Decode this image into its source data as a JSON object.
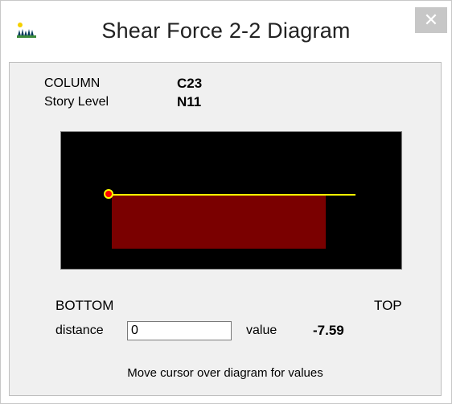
{
  "window": {
    "title": "Shear Force 2-2 Diagram",
    "close_label": "✕"
  },
  "info": {
    "column_label": "COLUMN",
    "column_value": "C23",
    "story_label": "Story Level",
    "story_value": "N11"
  },
  "diagram": {
    "fill_color": "#7a0000",
    "line_color": "#ffff00",
    "marker_color": "#ff0000",
    "background": "#000000"
  },
  "ends": {
    "bottom": "BOTTOM",
    "top": "TOP"
  },
  "readout": {
    "distance_label": "distance",
    "distance_value": "0",
    "value_label": "value",
    "value": "-7.59"
  },
  "hint": "Move cursor over diagram for values"
}
